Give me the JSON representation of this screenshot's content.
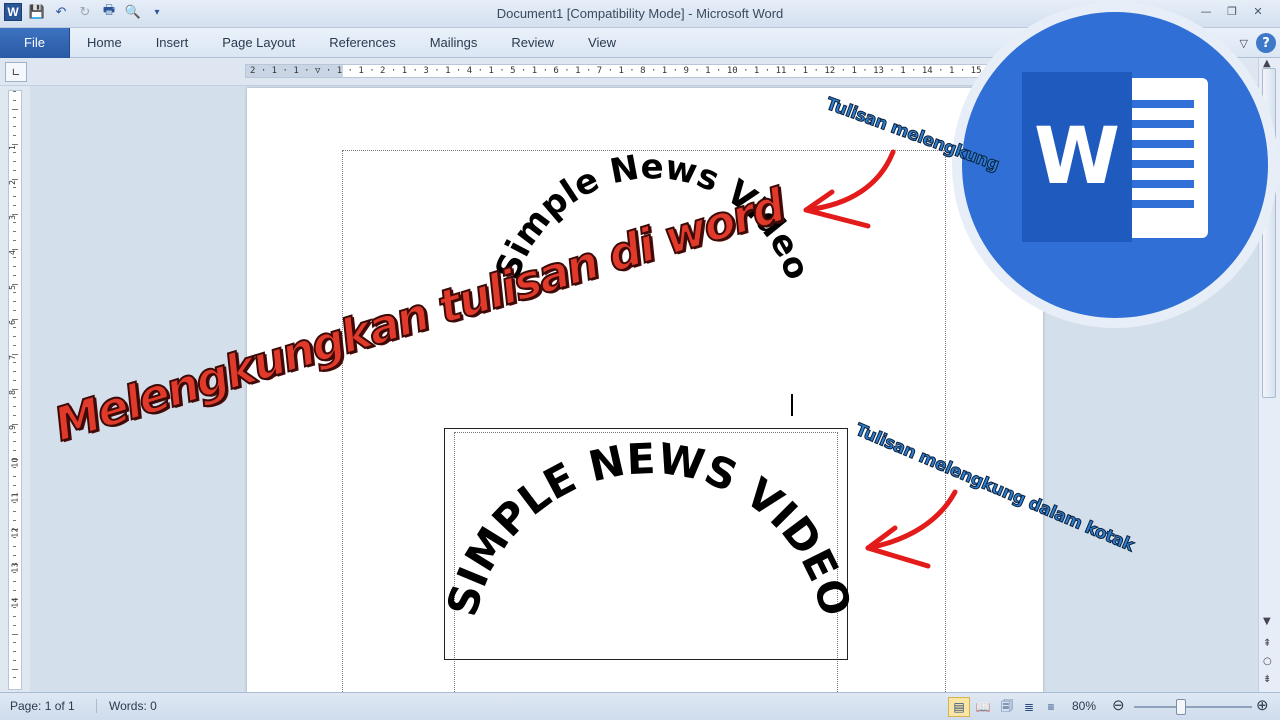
{
  "window": {
    "title": "Document1 [Compatibility Mode] - Microsoft Word"
  },
  "ribbon": {
    "tabs": [
      {
        "label": "File",
        "active": true
      },
      {
        "label": "Home"
      },
      {
        "label": "Insert"
      },
      {
        "label": "Page Layout"
      },
      {
        "label": "References"
      },
      {
        "label": "Mailings"
      },
      {
        "label": "Review"
      },
      {
        "label": "View"
      }
    ]
  },
  "ruler": {
    "horizontal_text": "2 · 1 · 1 · ▽ · 1 · 1 · 2 · 1 · 3 · 1 · 4 · 1 · 5 · 1 · 6 · 1 · 7 · 1 · 8 · 1 · 9 · 1 · 10 · 1 · 11 · 1 · 12 · 1 · 13 · 1 · 14 · 1 · 15 · 1 · 16 · △ · 17",
    "vertical_numbers": [
      "1",
      "2",
      "3",
      "4",
      "5",
      "6",
      "7",
      "8",
      "9",
      "10",
      "11",
      "12",
      "13",
      "14"
    ]
  },
  "document": {
    "curved_text_1": "Simple News Video",
    "curved_text_2": "SIMPLE NEWS VIDEO"
  },
  "overlays": {
    "big_title": "Melengkungkan tulisan di word",
    "caption_top": "Tulisan melengkung",
    "caption_box": "Tulisan melengkung dalam kotak"
  },
  "logo": {
    "letter": "W"
  },
  "statusbar": {
    "page": "Page: 1 of 1",
    "words": "Words: 0",
    "zoom": "80%"
  },
  "colors": {
    "word_blue": "#2f6fd6",
    "arrow_red": "#e31b1b",
    "title_red": "#e23a2a"
  }
}
